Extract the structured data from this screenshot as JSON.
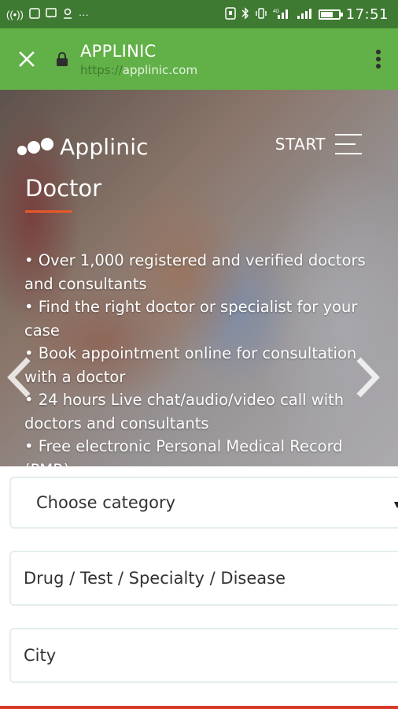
{
  "status_bar": {
    "time": "17:51",
    "left_icons": [
      "hotspot-icon",
      "sim-icon",
      "message-icon",
      "notification-icon",
      "more-icon"
    ],
    "right_icons": [
      "nfc-icon",
      "bluetooth-icon",
      "vibrate-icon",
      "signal-icon",
      "signal-icon",
      "battery-icon"
    ],
    "battery_level": 0.65
  },
  "browser": {
    "title": "APPLINIC",
    "url_scheme": "https://",
    "url_host": "applinic.com",
    "toolbar_color": "#62b048"
  },
  "hero": {
    "brand": "Applinic",
    "start_label": "START",
    "title": "Doctor",
    "bullets": [
      "• Over 1,000 registered and verified doctors and consultants",
      "• Find the right doctor or specialist for your case",
      "• Book appointment online for consultation with a doctor",
      "• 24 hours Live chat/audio/video call with doctors and consultants",
      "• Free electronic Personal Medical Record (PMR)"
    ],
    "accent_color": "#e8582a"
  },
  "form": {
    "category_select": "Choose category",
    "drug_field": "Drug / Test / Specialty / Disease",
    "city_field": "City"
  }
}
